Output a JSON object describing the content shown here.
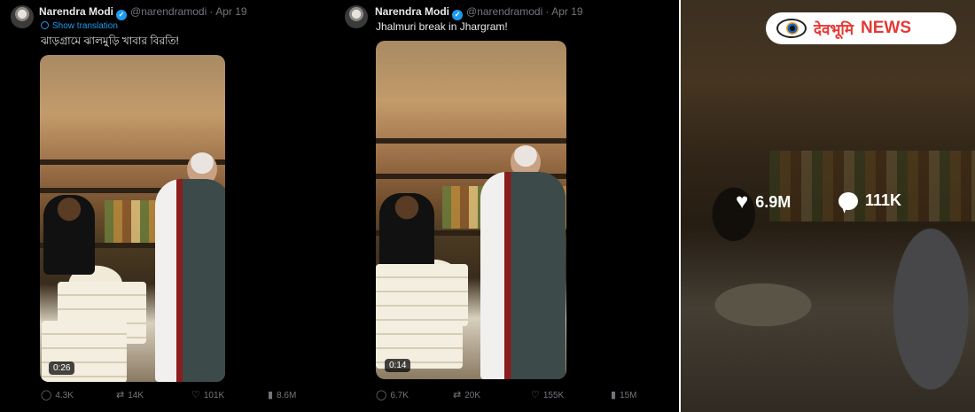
{
  "posts": [
    {
      "author": "Narendra Modi",
      "handle": "@narendramodi",
      "separator": "·",
      "date": "Apr 19",
      "show_translation": "Show translation",
      "text": "ঝাড়গ্রামে ঝালমুড়ি খাবার বিরতি!",
      "video_time": "0:26",
      "stats": {
        "replies": "4.3K",
        "reposts": "14K",
        "likes": "101K",
        "views": "8.6M"
      }
    },
    {
      "author": "Narendra Modi",
      "handle": "@narendramodi",
      "separator": "·",
      "date": "Apr 19",
      "text": "Jhalmuri break in Jhargram!",
      "video_time": "0:14",
      "stats": {
        "replies": "6.7K",
        "reposts": "20K",
        "likes": "155K",
        "views": "15M"
      }
    }
  ],
  "overlay": {
    "logo_hindi": "देवभूमि",
    "logo_english": "NEWS",
    "likes": "6.9M",
    "comments": "111K"
  },
  "icons": {
    "reply": "speech-bubble",
    "repost": "repeat-arrows",
    "like": "heart",
    "views": "bar-chart",
    "verified": "check-badge"
  },
  "colors": {
    "accent": "#1d9bf0",
    "muted": "#71767b",
    "logo_red": "#e53935"
  }
}
